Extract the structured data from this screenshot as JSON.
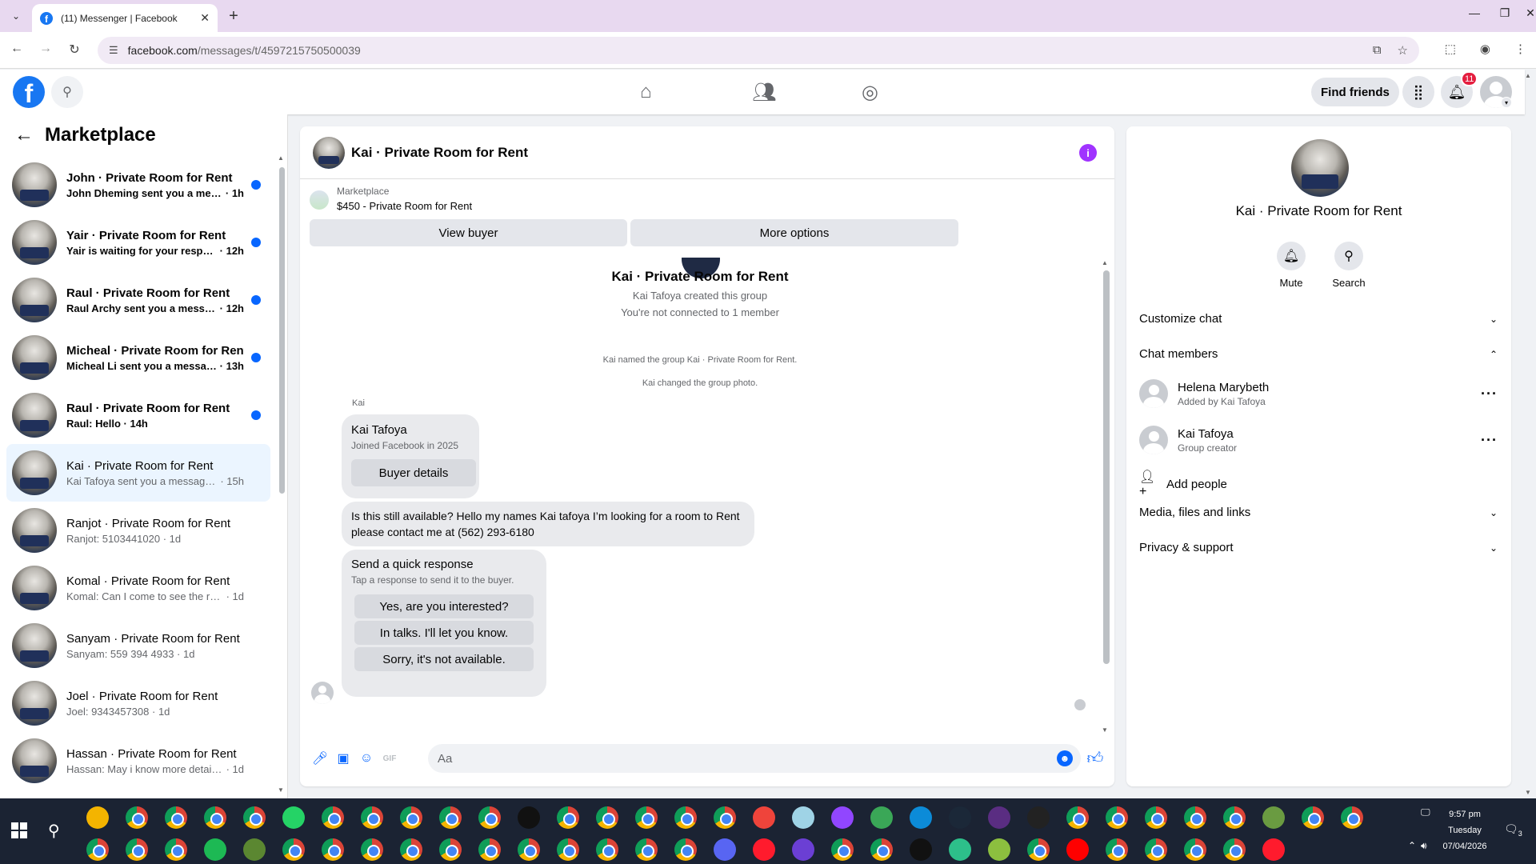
{
  "browser": {
    "tab_title": "(11) Messenger | Facebook",
    "url_host": "facebook.com",
    "url_path": "/messages/t/4597215750500039"
  },
  "fbnav": {
    "find_friends": "Find friends",
    "notification_count": "11"
  },
  "left_panel": {
    "title": "Marketplace",
    "conversations": [
      {
        "name": "John · Private Room for Rent",
        "preview": "John Dheming sent you a mes...",
        "time": "1h",
        "unread": true
      },
      {
        "name": "Yair · Private Room for Rent",
        "preview": "Yair is waiting for your respon...",
        "time": "12h",
        "unread": true
      },
      {
        "name": "Raul · Private Room for Rent",
        "preview": "Raul Archy sent you a messag...",
        "time": "12h",
        "unread": true
      },
      {
        "name": "Micheal · Private Room for Rent",
        "preview": "Micheal Li sent you a messag...",
        "time": "13h",
        "unread": true
      },
      {
        "name": "Raul · Private Room for Rent",
        "preview": "Raul: Hello",
        "time": "14h",
        "unread": true
      },
      {
        "name": "Kai · Private Room for Rent",
        "preview": "Kai Tafoya sent you a message a...",
        "time": "15h",
        "unread": false
      },
      {
        "name": "Ranjot · Private Room for Rent",
        "preview": "Ranjot: 5103441020",
        "time": "1d",
        "unread": false
      },
      {
        "name": "Komal · Private Room for Rent",
        "preview": "Komal: Can I come to see the room",
        "time": "1d",
        "unread": false
      },
      {
        "name": "Sanyam · Private Room for Rent",
        "preview": "Sanyam: 559 394 4933",
        "time": "1d",
        "unread": false
      },
      {
        "name": "Joel · Private Room for Rent",
        "preview": "Joel: 9343457308",
        "time": "1d",
        "unread": false
      },
      {
        "name": "Hassan · Private Room for Rent",
        "preview": "Hassan: May i know more details?",
        "time": "1d",
        "unread": false
      }
    ]
  },
  "chat": {
    "header_name": "Kai · Private Room for Rent",
    "marketplace_label": "Marketplace",
    "listing": "$450 - Private Room for Rent",
    "view_buyer": "View buyer",
    "more_options": "More options",
    "group_title": "Kai · Private Room for Rent",
    "sys_created": "Kai Tafoya created this group",
    "sys_not_connected": "You're not connected to 1 member",
    "sys_named": "Kai named the group Kai · Private Room for Rent.",
    "sys_photo": "Kai changed the group photo.",
    "sender": "Kai",
    "card_name": "Kai Tafoya",
    "card_sub": "Joined Facebook in 2025",
    "card_btn": "Buyer details",
    "message": "Is this still available? Hello my names Kai tafoya I’m looking for a room to Rent please contact me at (562) 293-6180",
    "qr_title": "Send a quick response",
    "qr_sub": "Tap a response to send it to the buyer.",
    "qr_options": [
      "Yes, are you interested?",
      "In talks. I'll let you know.",
      "Sorry, it's not available."
    ],
    "composer_placeholder": "Aa"
  },
  "right_panel": {
    "name": "Kai · Private Room for Rent",
    "mute": "Mute",
    "search": "Search",
    "customize_chat": "Customize chat",
    "chat_members": "Chat members",
    "members": [
      {
        "name": "Helena Marybeth",
        "sub": "Added by Kai Tafoya"
      },
      {
        "name": "Kai Tafoya",
        "sub": "Group creator"
      }
    ],
    "add_people": "Add people",
    "media": "Media, files and links",
    "privacy": "Privacy & support"
  },
  "taskbar": {
    "time": "9:57 pm",
    "day": "Tuesday",
    "date": "07/04/2026",
    "notif_count": "3"
  },
  "colors": {
    "facebook_blue": "#1877f2",
    "messenger_blue": "#0866ff",
    "info_purple": "#a033ff",
    "badge_red": "#e41e3f"
  }
}
